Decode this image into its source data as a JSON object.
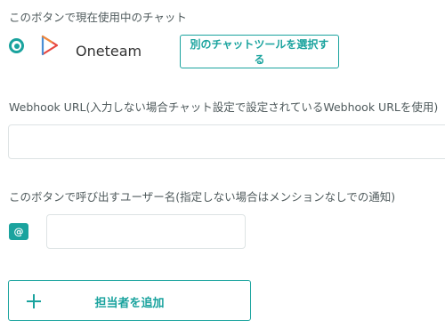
{
  "current_chat": {
    "label": "このボタンで現在使用中のチャット",
    "app_name": "Oneteam",
    "app_icon": "oneteam-logo-icon",
    "select_button_label": "別のチャットツールを選択する"
  },
  "webhook": {
    "label": "Webhook URL(入力しない場合チャット設定で設定されているWebhook URLを使用)",
    "value": "",
    "placeholder": ""
  },
  "mention": {
    "label": "このボタンで呼び出すユーザー名(指定しない場合はメンションなしでの通知)",
    "at_symbol": "@",
    "value": "",
    "placeholder": ""
  },
  "add_assignee": {
    "label": "担当者を追加",
    "icon": "plus-icon"
  },
  "colors": {
    "accent": "#1aa39e",
    "logo_orange": "#f08a3c",
    "logo_red": "#e8473f",
    "logo_blue": "#4a8fd6",
    "input_border": "#dde3e4",
    "label_text": "#4f5a5c"
  }
}
